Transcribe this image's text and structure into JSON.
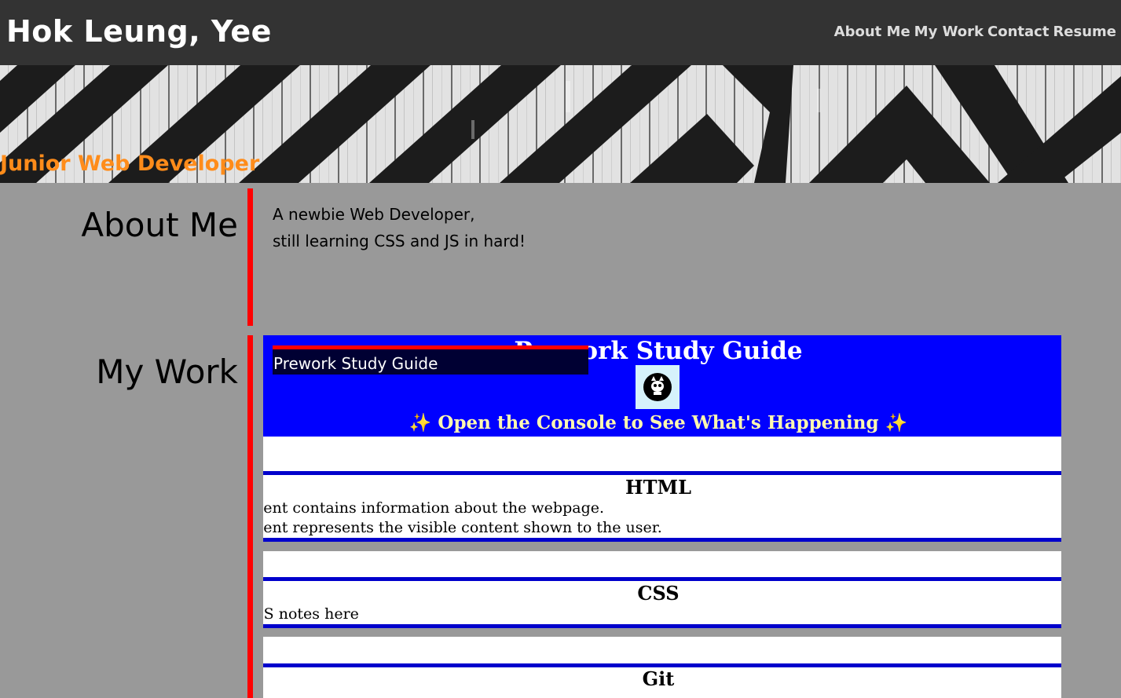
{
  "header": {
    "site_name": "Hok Leung, Yee",
    "nav": [
      "About Me",
      "My Work",
      "Contact",
      "Resume"
    ]
  },
  "hero": {
    "tagline": "Junior Web Developer",
    "tagline_color": "#ff8c1a"
  },
  "about": {
    "title": "About Me",
    "line1": "A newbie Web Developer,",
    "line2": "still learning CSS and JS in hard!"
  },
  "work": {
    "title": "My Work",
    "project_label": "Prework Study Guide",
    "preview": {
      "title": "Prework Study Guide",
      "subtitle": "✨ Open the Console to See What's Happening ✨",
      "sections": [
        {
          "heading": "HTML",
          "lines": [
            "nent contains information about the webpage.",
            "nent represents the visible content shown to the user."
          ]
        },
        {
          "heading": "CSS",
          "lines": [
            "SS notes here"
          ]
        },
        {
          "heading": "Git",
          "lines": []
        }
      ]
    }
  },
  "colors": {
    "topbar": "#333333",
    "page_bg": "#999999",
    "accent_rule": "#ff0000",
    "preview_header": "#0000ff"
  }
}
